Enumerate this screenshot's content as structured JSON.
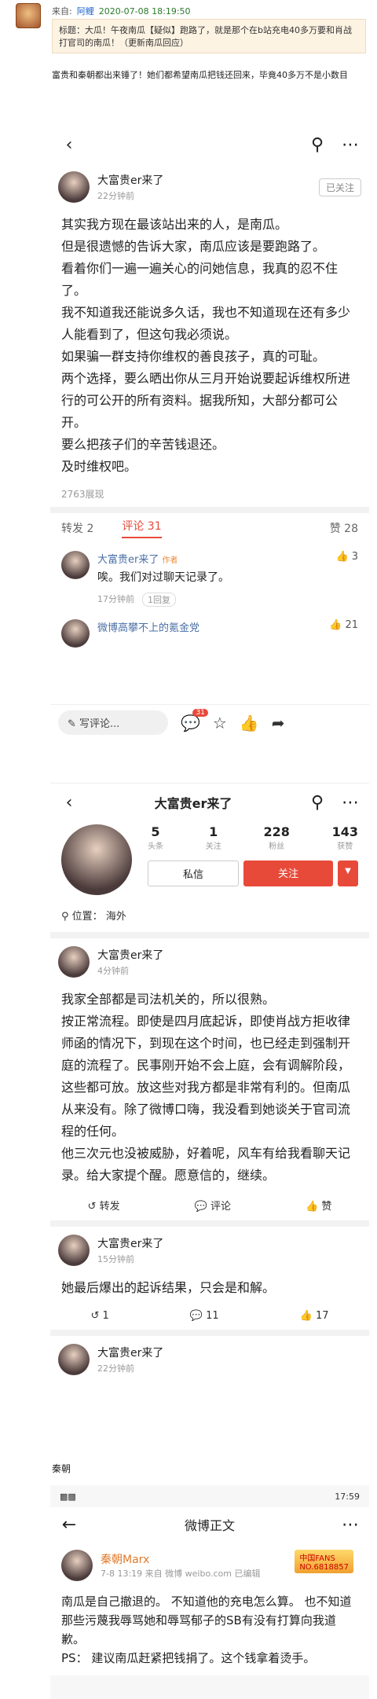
{
  "forum": {
    "from_label": "来自:",
    "author": "阿鲤",
    "date": "2020-07-08 18:19:50",
    "quote": "标题：大瓜！午夜南瓜【疑似】跑路了，就是那个在b站充电40多万要和肖战打官司的南瓜！（更新南瓜回应）",
    "post_text": "富贵和秦朝都出来锤了！她们都希望南瓜把钱还回来，毕竟40多万不是小数目",
    "section_label": "秦朝"
  },
  "panel1": {
    "user_name": "大富贵er来了",
    "user_time": "22分钟前",
    "follow_label": "已关注",
    "body": [
      "其实我方现在最该站出来的人，是南瓜。",
      "但是很遗憾的告诉大家，南瓜应该是要跑路了。",
      "看着你们一遍一遍关心的问她信息，我真的忍不住了。",
      "我不知道我还能说多久话，我也不知道现在还有多少人能看到了，但这句我必须说。",
      "如果骗一群支持你维权的善良孩子，真的可耻。",
      "两个选择，要么晒出你从三月开始说要起诉维权所进行的可公开的所有资料。据我所知，大部分都可公开。",
      "要么把孩子们的辛苦钱退还。",
      "及时维权吧。"
    ],
    "read_count": "2763展现",
    "tab_repost": "转发 2",
    "tab_comment": "评论 31",
    "tab_like": "赞 28",
    "comment1": {
      "name": "大富贵er来了",
      "tag": "作者",
      "text": "唉。我们对过聊天记录了。",
      "time": "17分钟前",
      "reply": "1回复",
      "likes": "3"
    },
    "comment2": {
      "name": "微博高攀不上的氪金党",
      "likes": "21"
    },
    "write_placeholder": "写评论...",
    "comment_badge": "31"
  },
  "panel2": {
    "title": "大富贵er来了",
    "stats": [
      {
        "num": "5",
        "label": "头条"
      },
      {
        "num": "1",
        "label": "关注"
      },
      {
        "num": "228",
        "label": "粉丝"
      },
      {
        "num": "143",
        "label": "获赞"
      }
    ],
    "msg_label": "私信",
    "follow_label": "关注",
    "location_label": "位置：",
    "location_value": "海外",
    "post1": {
      "name": "大富贵er来了",
      "time": "4分钟前",
      "body": [
        "我家全部都是司法机关的，所以很熟。",
        "按正常流程。即使是四月底起诉，即使肖战方拒收律师函的情况下，到现在这个时间，也已经走到强制开庭的流程了。民事刚开始不会上庭，会有调解阶段，这些都可放。放这些对我方都是非常有利的。但南瓜从来没有。除了微博口嗨，我没看到她谈关于官司流程的任何。",
        "他三次元也没被威胁，好着呢，风车有给我看聊天记录。给大家提个醒。愿意信的，继续。"
      ],
      "repost": "转发",
      "comment": "评论",
      "like": "赞"
    },
    "post2": {
      "name": "大富贵er来了",
      "time": "15分钟前",
      "body": "她最后爆出的起诉结果，只会是和解。",
      "repost": "1",
      "comment": "11",
      "like": "17"
    },
    "post3": {
      "name": "大富贵er来了",
      "time": "22分钟前"
    }
  },
  "panel3": {
    "time": "17:59",
    "title": "微博正文",
    "user_name": "秦朝Marx",
    "meta": "7-8 13:19  来自 微博 weibo.com  已编辑",
    "fans_badge": "NO.6818857",
    "fans_title": "中国FANS",
    "body": [
      "南瓜是自己撤退的。 不知道他的充电怎么算。 也不知道那些污蔑我辱骂她和辱骂郁子的SB有没有打算向我道歉。",
      "PS： 建议南瓜赶紧把钱捐了。这个钱拿着烫手。"
    ]
  },
  "colors": {
    "accent": "#e84a3a",
    "link": "#2266cc",
    "quote_bg": "#fdf3e3"
  }
}
